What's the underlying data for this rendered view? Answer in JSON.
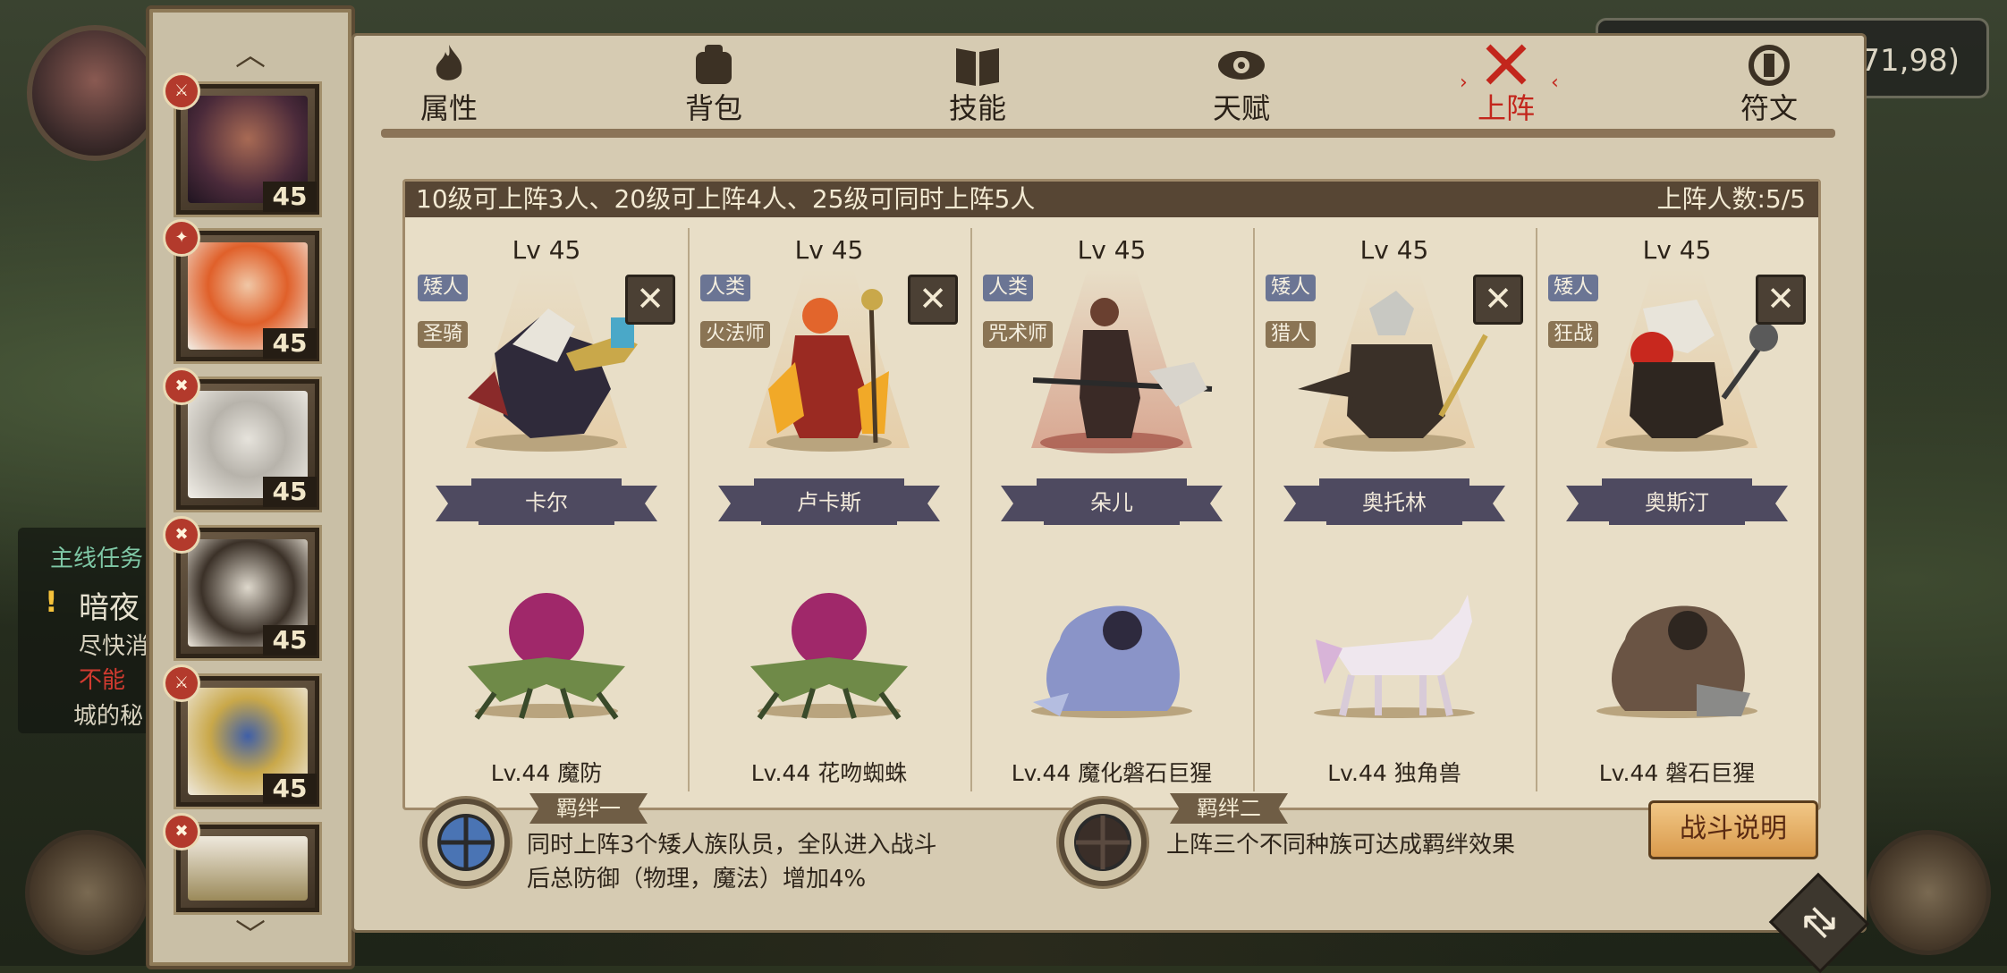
{
  "background": {
    "coord_text": "71,98)",
    "quest": {
      "header": "主线任务",
      "title": "暗夜",
      "line1": "尽快消",
      "line2": "不能",
      "line3": "城的秘"
    }
  },
  "sidebar": {
    "heroes": [
      {
        "level": "45",
        "class_icon": "sword"
      },
      {
        "level": "45",
        "class_icon": "staff"
      },
      {
        "level": "45",
        "class_icon": "axe"
      },
      {
        "level": "45",
        "class_icon": "axe"
      },
      {
        "level": "45",
        "class_icon": "sword"
      },
      {
        "level": "",
        "class_icon": "axe"
      }
    ]
  },
  "tabs": [
    {
      "label": "属性",
      "icon": "flame-icon"
    },
    {
      "label": "背包",
      "icon": "bag-icon"
    },
    {
      "label": "技能",
      "icon": "book-icon"
    },
    {
      "label": "天赋",
      "icon": "eye-icon"
    },
    {
      "label": "上阵",
      "icon": "crossed-swords-icon"
    },
    {
      "label": "符文",
      "icon": "rune-icon"
    }
  ],
  "lineup": {
    "info_left": "10级可上阵3人、20级可上阵4人、25级可同时上阵5人",
    "info_right": "上阵人数:5/5",
    "slots": [
      {
        "level": "Lv 45",
        "race": "矮人",
        "class": "圣骑",
        "name": "卡尔",
        "pet": "Lv.44 魔防"
      },
      {
        "level": "Lv 45",
        "race": "人类",
        "class": "火法师",
        "name": "卢卡斯",
        "pet": "Lv.44 花吻蜘蛛"
      },
      {
        "level": "Lv 45",
        "race": "人类",
        "class": "咒术师",
        "name": "朵儿",
        "pet": "Lv.44 魔化磐石巨猩"
      },
      {
        "level": "Lv 45",
        "race": "矮人",
        "class": "猎人",
        "name": "奥托林",
        "pet": "Lv.44 独角兽"
      },
      {
        "level": "Lv 45",
        "race": "矮人",
        "class": "狂战",
        "name": "奥斯汀",
        "pet": "Lv.44 磐石巨猩"
      }
    ],
    "remove_symbol": "✕"
  },
  "bonds": {
    "bond1": {
      "tag": "羁绊一",
      "line1": "同时上阵3个矮人族队员，全队进入战斗",
      "line2": "后总防御（物理，魔法）增加4%"
    },
    "bond2": {
      "tag": "羁绊二",
      "line1": "上阵三个不同种族可达成羁绊效果"
    }
  },
  "battle_button": "战斗说明",
  "colors": {
    "panel_bg": "#d6cbb2",
    "accent_red": "#c3261c",
    "info_bar": "#574634",
    "race_tag": "#6b7594",
    "class_tag": "#8a7454"
  }
}
